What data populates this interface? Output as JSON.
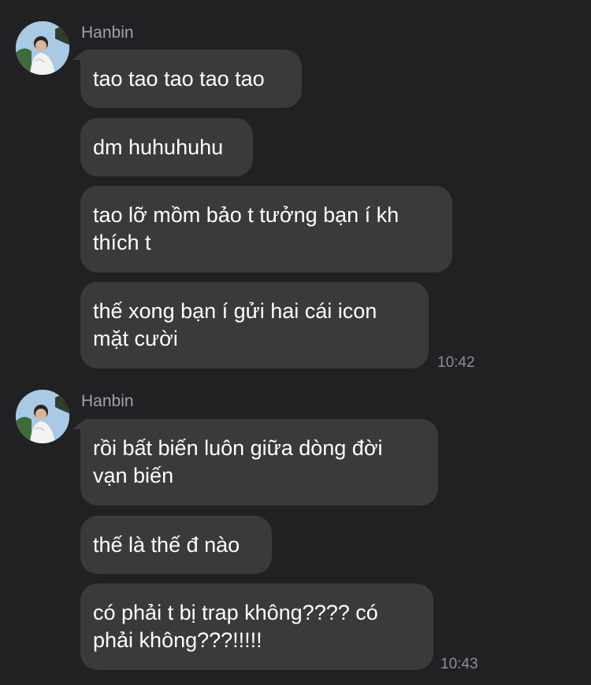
{
  "colors": {
    "background": "#212124",
    "bubble": "#3a3a3d",
    "sender_name": "#a2a2a8",
    "timestamp": "#8e8e93"
  },
  "groups": [
    {
      "sender": "Hanbin",
      "avatar_icon": "profile-photo-icon",
      "messages": [
        "tao tao tao tao tao",
        "dm huhuhuhu",
        "tao lỡ mồm bảo t tưởng bạn í kh\nthích t",
        "thế xong bạn í gửi hai cái icon\nmặt cười"
      ],
      "timestamp": "10:42"
    },
    {
      "sender": "Hanbin",
      "avatar_icon": "profile-photo-icon",
      "messages": [
        "rồi bất biến luôn giữa dòng đời\nvạn biến",
        "thế là thế đ nào",
        "có phải t bị trap không???? có\nphải không???!!!!!"
      ],
      "timestamp": "10:43"
    }
  ]
}
